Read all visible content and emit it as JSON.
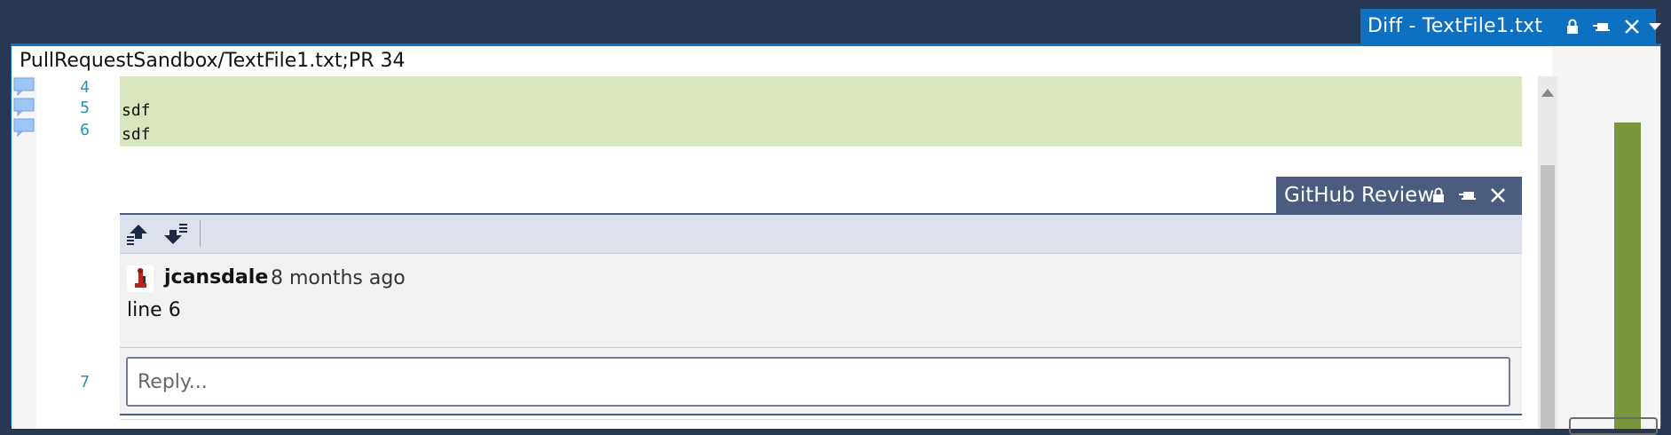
{
  "document_tab": {
    "title": "Diff - TextFile1.txt",
    "icons": [
      "lock-icon",
      "pin-icon",
      "close-icon"
    ]
  },
  "window_menu_icon": "chevron-down-icon",
  "path_bar": {
    "text": "PullRequestSandbox/TextFile1.txt;PR 34"
  },
  "editor": {
    "lines": [
      {
        "number": "4",
        "text": "",
        "has_comment": true
      },
      {
        "number": "5",
        "text": "sdf",
        "has_comment": true
      },
      {
        "number": "6",
        "text": "sdf",
        "has_comment": true
      }
    ],
    "after_line_number": "7"
  },
  "review": {
    "tab_title": "GitHub Review",
    "toolbar": {
      "previous_comment_icon": "previous-comment-icon",
      "next_comment_icon": "next-comment-icon"
    },
    "comment": {
      "author": "jcansdale",
      "timestamp": "8 months ago",
      "body": "line 6"
    },
    "reply_placeholder": "Reply..."
  },
  "colors": {
    "background": "#293752",
    "accent": "#0e70c0",
    "added_line": "#d8e5bd",
    "review_header": "#4b5c80",
    "overview_added": "#7a963d",
    "line_number": "#2b91af"
  }
}
